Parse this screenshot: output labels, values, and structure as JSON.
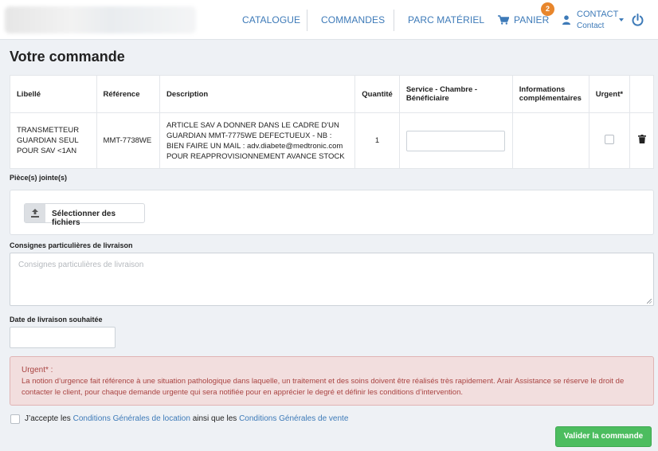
{
  "header": {
    "nav": [
      {
        "label": "CATALOGUE"
      },
      {
        "label": "COMMANDES"
      },
      {
        "label": "PARC MATÉRIEL"
      }
    ],
    "cart": {
      "label": "PANIER",
      "badge": "2",
      "icon": "shopping-cart-icon"
    },
    "user": {
      "name": "CONTACT",
      "sub": "Contact",
      "icon": "user-icon"
    },
    "logout_icon": "power-icon"
  },
  "page": {
    "title": "Votre commande"
  },
  "table": {
    "headers": {
      "libelle": "Libellé",
      "reference": "Référence",
      "description": "Description",
      "quantite": "Quantité",
      "service": "Service - Chambre - Bénéficiaire",
      "infos": "Informations complémentaires",
      "urgent": "Urgent*"
    },
    "rows": [
      {
        "libelle": "TRANSMETTEUR GUARDIAN SEUL POUR SAV <1AN",
        "reference": "MMT-7738WE",
        "description": "ARTICLE SAV A DONNER DANS LE CADRE D'UN GUARDIAN MMT-7775WE DEFECTUEUX - NB : BIEN FAIRE UN MAIL : adv.diabete@medtronic.com POUR REAPPROVISIONNEMENT AVANCE STOCK",
        "quantite": "1",
        "service": "",
        "infos": "",
        "urgent": false
      }
    ]
  },
  "attachments": {
    "label": "Pièce(s) jointe(s)",
    "button": "Sélectionner des fichiers"
  },
  "delivery_notes": {
    "label": "Consignes particulières de livraison",
    "placeholder": "Consignes particulières de livraison",
    "value": ""
  },
  "delivery_date": {
    "label": "Date de livraison souhaitée",
    "value": ""
  },
  "alert": {
    "title": "Urgent* :",
    "text": "La notion d’urgence fait référence à une situation pathologique dans laquelle, un traitement et des soins doivent être réalisés très rapidement. Arair Assistance se réserve le droit de contacter le client, pour chaque demande urgente qui sera notifiée pour en apprécier le degré et définir les conditions d’intervention."
  },
  "terms": {
    "prefix": "J’accepte les",
    "link1": "Conditions Générales de location",
    "middle": "ainsi que les",
    "link2": "Conditions Générales de vente",
    "checked": false
  },
  "submit": {
    "label": "Valider la commande"
  },
  "colors": {
    "accent": "#3d7ab8",
    "badge": "#e8862c",
    "submit": "#4cbd5f",
    "alert_text": "#a94442",
    "alert_bg": "#f2dede"
  }
}
